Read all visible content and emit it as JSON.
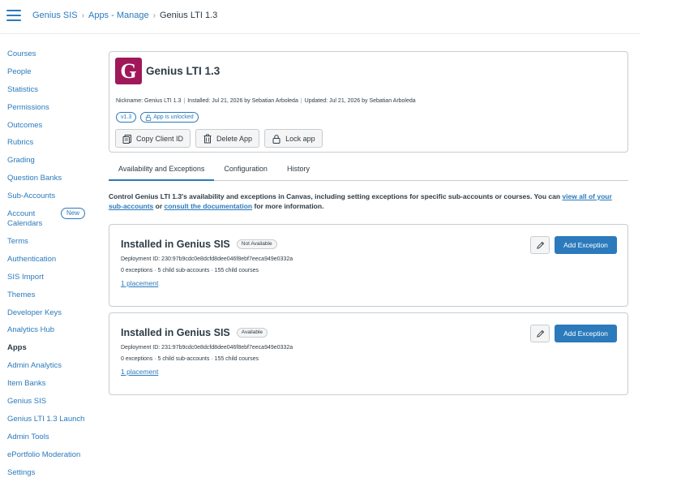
{
  "header": {
    "breadcrumb": [
      "Genius SIS",
      "Apps - Manage",
      "Genius LTI 1.3"
    ]
  },
  "sidebar": {
    "items": [
      {
        "label": "Courses"
      },
      {
        "label": "People"
      },
      {
        "label": "Statistics"
      },
      {
        "label": "Permissions"
      },
      {
        "label": "Outcomes"
      },
      {
        "label": "Rubrics"
      },
      {
        "label": "Grading"
      },
      {
        "label": "Question Banks"
      },
      {
        "label": "Sub-Accounts"
      },
      {
        "label": "Account Calendars",
        "badge": "New"
      },
      {
        "label": "Terms"
      },
      {
        "label": "Authentication"
      },
      {
        "label": "SIS Import"
      },
      {
        "label": "Themes"
      },
      {
        "label": "Developer Keys"
      },
      {
        "label": "Analytics Hub"
      },
      {
        "label": "Apps",
        "active": true
      },
      {
        "label": "Admin Analytics"
      },
      {
        "label": "Item Banks"
      },
      {
        "label": "Genius SIS"
      },
      {
        "label": "Genius LTI 1.3 Launch"
      },
      {
        "label": "Admin Tools"
      },
      {
        "label": "ePortfolio Moderation"
      },
      {
        "label": "Settings"
      }
    ]
  },
  "app": {
    "logo_letter": "G",
    "logo_color": "#a1185a",
    "title": "Genius LTI 1.3",
    "nickname": "Nickname: Genius LTI 1.3",
    "installed": "Installed: Jul 21, 2026 by Sebatian Arboleda",
    "updated": "Updated: Jul 21, 2026 by Sebatian Arboleda",
    "version": "v1.3",
    "lock_status": "App is unlocked",
    "buttons": {
      "copy_client_id": "Copy Client ID",
      "delete_app": "Delete App",
      "lock_app": "Lock app"
    }
  },
  "tabs": [
    "Availability and Exceptions",
    "Configuration",
    "History"
  ],
  "description": {
    "text": "Control Genius LTI 1.3's availability and exceptions in Canvas, including setting exceptions for specific sub-accounts or courses. You can ",
    "link1": "view all of your sub-accounts",
    "middle": " or ",
    "link2": "consult the documentation",
    "end": " for more information."
  },
  "deployments": [
    {
      "title": "Installed in Genius SIS",
      "status": "Not Available",
      "deployment_id": "Deployment ID: 230:97b9cdc0e8dcfd8dee046f8ebf7eeca949e0332a",
      "counts": "0 exceptions · 5 child sub-accounts · 155 child courses",
      "placements": "1 placement",
      "add_label": "Add Exception"
    },
    {
      "title": "Installed in Genius SIS",
      "status": "Available",
      "deployment_id": "Deployment ID: 231:97b9cdc0e8dcfd8dee046f8ebf7eeca949e0332a",
      "counts": "0 exceptions · 5 child sub-accounts · 155 child courses",
      "placements": "1 placement",
      "add_label": "Add Exception"
    }
  ],
  "colors": {
    "link": "#2b7abc",
    "text": "#2d3b45",
    "border": "#c7cdd1",
    "primary_button": "#2b7abc"
  }
}
